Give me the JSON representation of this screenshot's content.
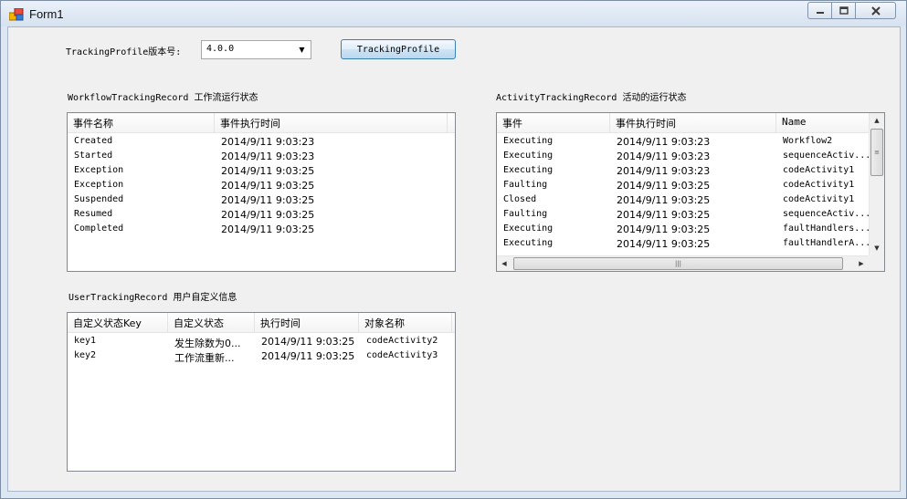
{
  "window": {
    "title": "Form1",
    "controls": {
      "minimize_icon": "minimize-icon",
      "maximize_icon": "maximize-icon",
      "close_icon": "close-icon"
    }
  },
  "top": {
    "version_label": "TrackingProfile版本号:",
    "version_value": "4.0.0",
    "button_label": "TrackingProfile"
  },
  "workflow": {
    "title": "WorkflowTrackingRecord 工作流运行状态",
    "columns": [
      "事件名称",
      "事件执行时间"
    ],
    "rows": [
      [
        "Created",
        "2014/9/11 9:03:23"
      ],
      [
        "Started",
        "2014/9/11 9:03:23"
      ],
      [
        "Exception",
        "2014/9/11 9:03:25"
      ],
      [
        "Exception",
        "2014/9/11 9:03:25"
      ],
      [
        "Suspended",
        "2014/9/11 9:03:25"
      ],
      [
        "Resumed",
        "2014/9/11 9:03:25"
      ],
      [
        "Completed",
        "2014/9/11 9:03:25"
      ]
    ]
  },
  "activity": {
    "title": "ActivityTrackingRecord 活动的运行状态",
    "columns": [
      "事件",
      "事件执行时间",
      "Name"
    ],
    "rows": [
      [
        "Executing",
        "2014/9/11 9:03:23",
        "Workflow2"
      ],
      [
        "Executing",
        "2014/9/11 9:03:23",
        "sequenceActiv..."
      ],
      [
        "Executing",
        "2014/9/11 9:03:23",
        "codeActivity1"
      ],
      [
        "Faulting",
        "2014/9/11 9:03:25",
        "codeActivity1"
      ],
      [
        "Closed",
        "2014/9/11 9:03:25",
        "codeActivity1"
      ],
      [
        "Faulting",
        "2014/9/11 9:03:25",
        "sequenceActiv..."
      ],
      [
        "Executing",
        "2014/9/11 9:03:25",
        "faultHandlers..."
      ],
      [
        "Executing",
        "2014/9/11 9:03:25",
        "faultHandlerA..."
      ]
    ]
  },
  "user": {
    "title": "UserTrackingRecord 用户自定义信息",
    "columns": [
      "自定义状态Key",
      "自定义状态",
      "执行时间",
      "对象名称"
    ],
    "rows": [
      [
        "key1",
        "发生除数为0...",
        "2014/9/11 9:03:25",
        "codeActivity2"
      ],
      [
        "key2",
        "工作流重新...",
        "2014/9/11 9:03:25",
        "codeActivity3"
      ]
    ]
  }
}
